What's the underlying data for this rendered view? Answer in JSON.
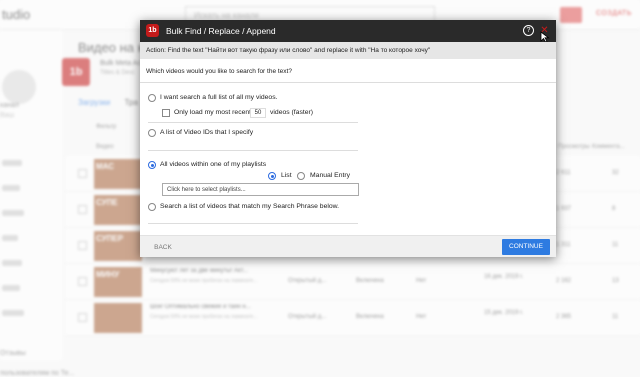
{
  "background": {
    "app_name": "tudio",
    "search_placeholder": "Искать на канале",
    "create_label": "СОЗДАТЬ",
    "page_title": "Видео на ка",
    "channel_logo": "1b",
    "channel_name": "Bulk Meta Ac",
    "channel_sub": "Titles & Desc",
    "tabs": [
      "Загрузки",
      "Тра"
    ],
    "filter_label": "Фильтр",
    "col_video": "Видео",
    "col_views": "Просмотры",
    "col_comments": "Коммента...",
    "sidebar_items": [
      "канал",
      "Ваш",
      "",
      "",
      "",
      "",
      "",
      "",
      "",
      "Отзывы",
      "пользователям по Те..."
    ],
    "rows": [
      {
        "thumb": "МАС",
        "title": "",
        "sub": "",
        "vis": "",
        "mon": "",
        "res": "",
        "date": "",
        "views": "2 611",
        "comm": "32"
      },
      {
        "thumb": "СУПЕ",
        "title": "",
        "sub": "",
        "vis": "",
        "mon": "",
        "res": "",
        "date": "",
        "views": "1 937",
        "comm": "8"
      },
      {
        "thumb": "СУПЕР",
        "title": "",
        "sub": "",
        "vis": "",
        "mon": "",
        "res": "",
        "date": "",
        "views": "1 311",
        "comm": "11"
      },
      {
        "thumb": "МИНУ",
        "title": "Минусуют лет за две минуты! Акт...",
        "sub": "Сегодня 59% не моих пробегах на ламинате...",
        "vis": "Открытый д...",
        "mon": "Включена",
        "res": "Нет",
        "date": "16 дек. 2019 г.",
        "views": "2 162",
        "comm": "13"
      },
      {
        "thumb": "",
        "title": "Шок! Оптимально свежие и тайн н...",
        "sub": "Сегодня 59% не моих пробегах на ламинате...",
        "vis": "Открытый д...",
        "mon": "Включена",
        "res": "Нет",
        "date": "15 дек. 2019 г.",
        "views": "2 365",
        "comm": "11"
      }
    ]
  },
  "dialog": {
    "logo": "1b",
    "title": "Bulk Find / Replace / Append",
    "help_glyph": "?",
    "close_glyph": "✕",
    "action_text": "Action: Find the text \"Найти вот такую фразу или слово\" and replace it with \"На то которое хочу\"",
    "question": "Which videos would you like to search for the text?",
    "options": {
      "full_list": "I want search a full list of all my videos.",
      "only_load_prefix": "Only load my most recent",
      "only_load_count": "50",
      "only_load_suffix": "videos (faster)",
      "video_ids": "A list of Video IDs that I specify",
      "playlists": "All videos within one of my playlists",
      "list_label": "List",
      "manual_label": "Manual Entry",
      "playlist_placeholder": "Click here to select playlists...",
      "search_phrase": "Search a list of videos that match my Search Phrase below."
    },
    "selected_option": "playlists",
    "selected_sub_option": "list",
    "back_label": "BACK",
    "continue_label": "CONTINUE",
    "accent_color": "#2e7be1",
    "brand_color": "#c41b1b"
  }
}
